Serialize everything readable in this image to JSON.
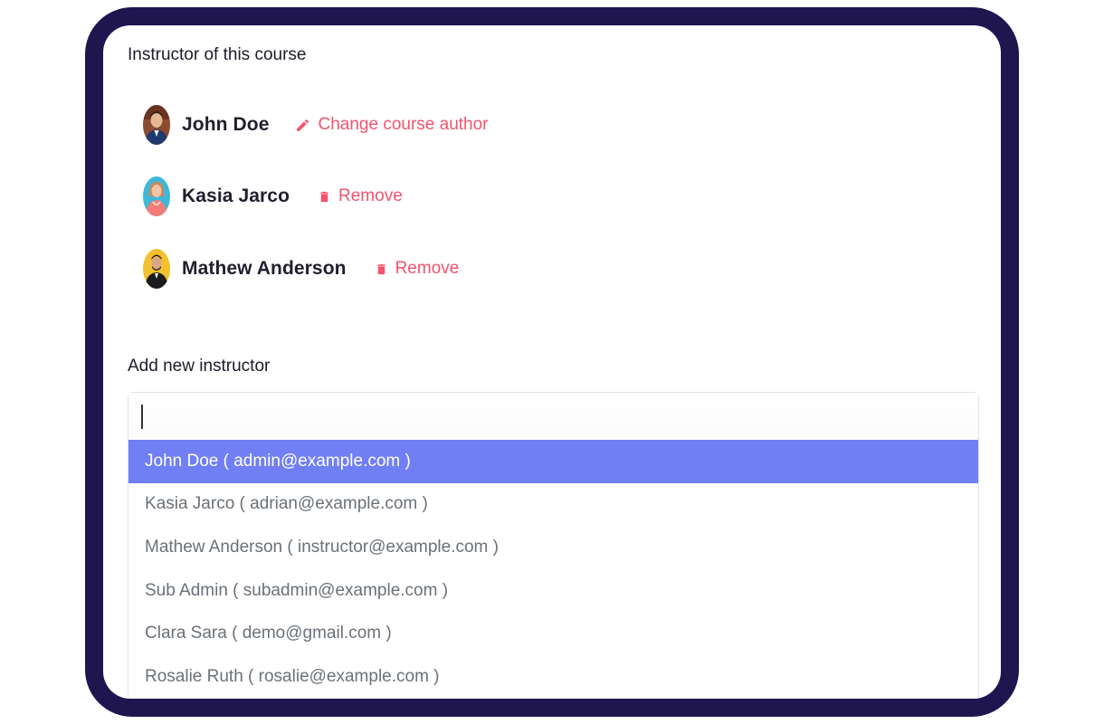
{
  "labels": {
    "instructors_heading": "Instructor of this course",
    "add_heading": "Add new instructor"
  },
  "instructors": [
    {
      "name": "John Doe",
      "action": "Change course author",
      "action_icon": "pencil-icon",
      "avatar_bg": "#8a4b2e"
    },
    {
      "name": "Kasia Jarco",
      "action": "Remove",
      "action_icon": "trash-icon",
      "avatar_bg": "#3fb7d9"
    },
    {
      "name": "Mathew Anderson",
      "action": "Remove",
      "action_icon": "trash-icon",
      "avatar_bg": "#f2c12e"
    }
  ],
  "search": {
    "value": ""
  },
  "options": [
    "John Doe ( admin@example.com )",
    "Kasia Jarco ( adrian@example.com )",
    "Mathew Anderson ( instructor@example.com )",
    "Sub Admin ( subadmin@example.com )",
    "Clara Sara ( demo@gmail.com )",
    "Rosalie Ruth ( rosalie@example.com )"
  ],
  "selected_option": "John Doe ( admin@example.com )",
  "colors": {
    "frame": "#1f1650",
    "accent_red": "#f2536d",
    "highlight": "#717ff4",
    "option_text": "#6b7178"
  }
}
